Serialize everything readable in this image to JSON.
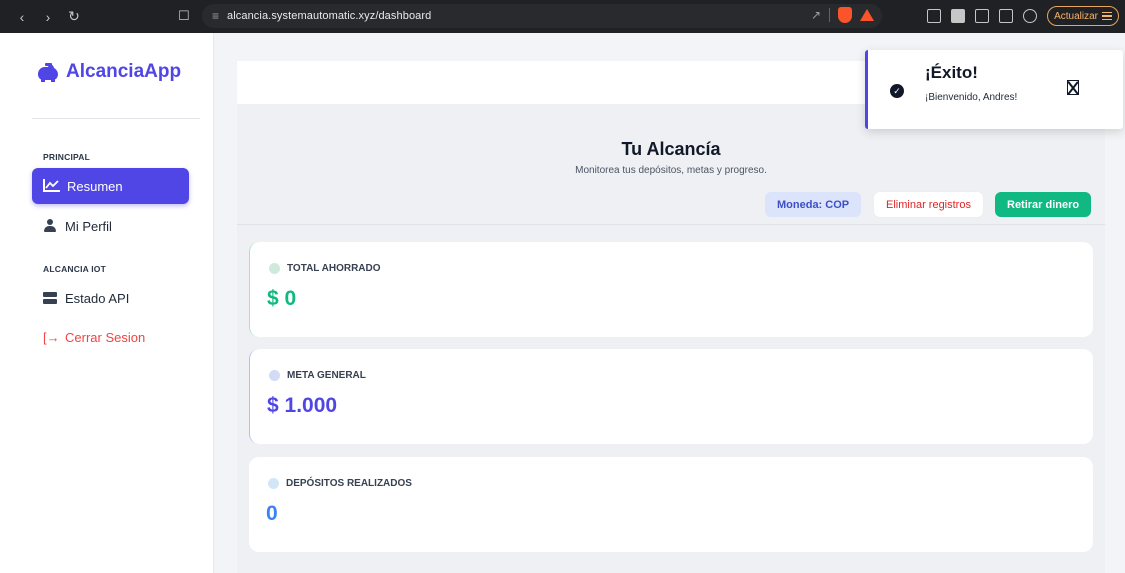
{
  "browser": {
    "url": "alcancia.systemautomatic.xyz/dashboard",
    "update_label": "Actualizar"
  },
  "sidebar": {
    "brand": "AlcanciaApp",
    "sections": [
      {
        "label": "PRINCIPAL"
      },
      {
        "label": "ALCANCIA IOT"
      }
    ],
    "items": [
      {
        "label": "Resumen",
        "icon": "chart-line-icon",
        "active": true
      },
      {
        "label": "Mi Perfil",
        "icon": "user-icon"
      },
      {
        "label": "Estado API",
        "icon": "server-icon"
      },
      {
        "label": "Cerrar Sesion",
        "icon": "logout-icon"
      }
    ]
  },
  "header": {
    "title": "Tu Alcancía",
    "subtitle": "Monitorea tus depósitos, metas y progreso.",
    "currency": "Moneda: COP",
    "delete_label": "Eliminar registros",
    "withdraw_label": "Retirar dinero"
  },
  "stats": [
    {
      "label": "TOTAL AHORRADO",
      "value": "$ 0",
      "color": "#10b981",
      "dot": "#cfe9dd"
    },
    {
      "label": "META GENERAL",
      "value": "$ 1.000",
      "color": "#4f46e5",
      "dot": "#d3dcf5"
    },
    {
      "label": "DEPÓSITOS REALIZADOS",
      "value": "0",
      "color": "#3b82f6",
      "dot": "#d2e6f7"
    }
  ],
  "toast": {
    "title": "¡Éxito!",
    "message": "¡Bienvenido, Andres!"
  },
  "colors": {
    "primary": "#4f46e5",
    "success": "#10b981",
    "danger": "#ef4444"
  }
}
